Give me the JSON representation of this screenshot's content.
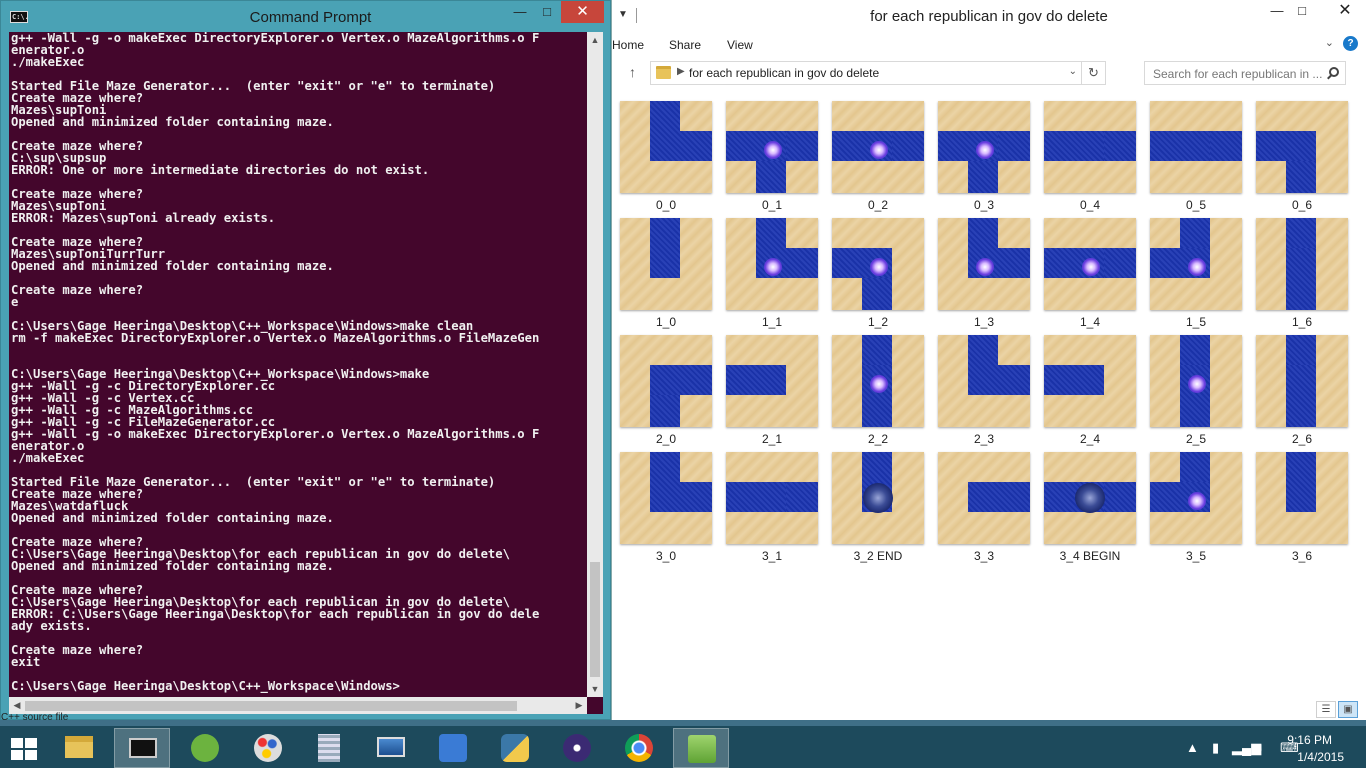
{
  "cmd": {
    "title": "Command Prompt",
    "icon_text": "C:\\.",
    "status_text": "C++ source file",
    "lines": [
      "g++ -Wall -g -o makeExec DirectoryExplorer.o Vertex.o MazeAlgorithms.o F",
      "enerator.o",
      "./makeExec",
      "",
      "Started File Maze Generator...  (enter \"exit\" or \"e\" to terminate)",
      "Create maze where?",
      "Mazes\\supToni",
      "Opened and minimized folder containing maze.",
      "",
      "Create maze where?",
      "C:\\sup\\supsup",
      "ERROR: One or more intermediate directories do not exist.",
      "",
      "Create maze where?",
      "Mazes\\supToni",
      "ERROR: Mazes\\supToni already exists.",
      "",
      "Create maze where?",
      "Mazes\\supToniTurrTurr",
      "Opened and minimized folder containing maze.",
      "",
      "Create maze where?",
      "e",
      "",
      "C:\\Users\\Gage Heeringa\\Desktop\\C++_Workspace\\Windows>make clean",
      "rm -f makeExec DirectoryExplorer.o Vertex.o MazeAlgorithms.o FileMazeGen",
      "",
      "",
      "C:\\Users\\Gage Heeringa\\Desktop\\C++_Workspace\\Windows>make",
      "g++ -Wall -g -c DirectoryExplorer.cc",
      "g++ -Wall -g -c Vertex.cc",
      "g++ -Wall -g -c MazeAlgorithms.cc",
      "g++ -Wall -g -c FileMazeGenerator.cc",
      "g++ -Wall -g -o makeExec DirectoryExplorer.o Vertex.o MazeAlgorithms.o F",
      "enerator.o",
      "./makeExec",
      "",
      "Started File Maze Generator...  (enter \"exit\" or \"e\" to terminate)",
      "Create maze where?",
      "Mazes\\watdafluck",
      "Opened and minimized folder containing maze.",
      "",
      "Create maze where?",
      "C:\\Users\\Gage Heeringa\\Desktop\\for each republican in gov do delete\\",
      "Opened and minimized folder containing maze.",
      "",
      "Create maze where?",
      "C:\\Users\\Gage Heeringa\\Desktop\\for each republican in gov do delete\\",
      "ERROR: C:\\Users\\Gage Heeringa\\Desktop\\for each republican in gov do dele",
      "ady exists.",
      "",
      "Create maze where?",
      "exit",
      "",
      "C:\\Users\\Gage Heeringa\\Desktop\\C++_Workspace\\Windows>"
    ]
  },
  "explorer": {
    "title": "for each republican in gov do delete",
    "ribbon_tabs": [
      "Home",
      "Share",
      "View"
    ],
    "address": "for each republican in gov do delete",
    "search_placeholder": "Search for each republican in ...",
    "help_label": "?",
    "tiles": [
      {
        "label": "0_0",
        "shape": "ne",
        "extra": ""
      },
      {
        "label": "0_1",
        "shape": "esw",
        "extra": "sprite"
      },
      {
        "label": "0_2",
        "shape": "ew",
        "extra": "sprite"
      },
      {
        "label": "0_3",
        "shape": "esw",
        "extra": "sprite"
      },
      {
        "label": "0_4",
        "shape": "ew",
        "extra": ""
      },
      {
        "label": "0_5",
        "shape": "ew",
        "extra": ""
      },
      {
        "label": "0_6",
        "shape": "sw",
        "extra": ""
      },
      {
        "label": "1_0",
        "shape": "n",
        "extra": ""
      },
      {
        "label": "1_1",
        "shape": "ne",
        "extra": "sprite"
      },
      {
        "label": "1_2",
        "shape": "sw",
        "extra": "sprite"
      },
      {
        "label": "1_3",
        "shape": "ne",
        "extra": "sprite"
      },
      {
        "label": "1_4",
        "shape": "ew",
        "extra": "sprite"
      },
      {
        "label": "1_5",
        "shape": "nw",
        "extra": "sprite"
      },
      {
        "label": "1_6",
        "shape": "ns",
        "extra": ""
      },
      {
        "label": "2_0",
        "shape": "se",
        "extra": ""
      },
      {
        "label": "2_1",
        "shape": "w",
        "extra": ""
      },
      {
        "label": "2_2",
        "shape": "ns",
        "extra": "sprite"
      },
      {
        "label": "2_3",
        "shape": "ne",
        "extra": ""
      },
      {
        "label": "2_4",
        "shape": "w",
        "extra": ""
      },
      {
        "label": "2_5",
        "shape": "ns",
        "extra": "sprite"
      },
      {
        "label": "2_6",
        "shape": "ns",
        "extra": ""
      },
      {
        "label": "3_0",
        "shape": "ne",
        "extra": ""
      },
      {
        "label": "3_1",
        "shape": "ew",
        "extra": ""
      },
      {
        "label": "3_2 END",
        "shape": "n",
        "extra": "portal"
      },
      {
        "label": "3_3",
        "shape": "e",
        "extra": ""
      },
      {
        "label": "3_4 BEGIN",
        "shape": "ew",
        "extra": "portal"
      },
      {
        "label": "3_5",
        "shape": "nw",
        "extra": "sprite"
      },
      {
        "label": "3_6",
        "shape": "n",
        "extra": ""
      }
    ]
  },
  "taskbar": {
    "apps": [
      "start-button",
      "file-explorer",
      "command-prompt",
      "utorrent",
      "paint",
      "calculator",
      "remote-desktop",
      "security-app",
      "python",
      "eclipse",
      "chrome",
      "notepad-plus-plus"
    ],
    "time": "9:16 PM",
    "date": "1/4/2015"
  },
  "colors": {
    "cmd_bg": "#44062c",
    "maze_path": "#1c35b2",
    "maze_floor": "#ebd3a4",
    "taskbar": "#1d4a5c"
  }
}
